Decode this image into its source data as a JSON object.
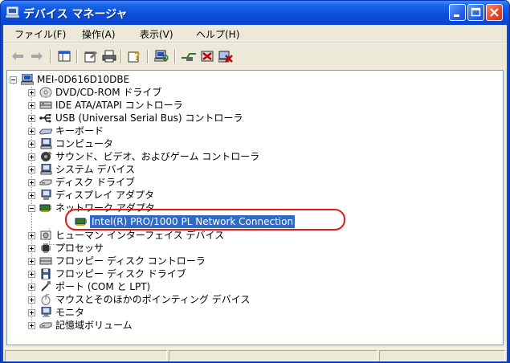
{
  "window": {
    "title": "デバイス マネージャ"
  },
  "menu": [
    {
      "label": "ファイル(F)"
    },
    {
      "label": "操作(A)"
    },
    {
      "label": "表示(V)"
    },
    {
      "label": "ヘルプ(H)"
    }
  ],
  "toolbar": {
    "buttons": [
      {
        "icon": "back-arrow-icon"
      },
      {
        "icon": "forward-arrow-icon"
      },
      {
        "icon": "show-hide-tree-icon"
      },
      {
        "icon": "properties-icon"
      },
      {
        "icon": "print-icon"
      },
      {
        "icon": "help-icon"
      },
      {
        "icon": "scan-hardware-changes-icon"
      },
      {
        "icon": "update-driver-icon"
      },
      {
        "icon": "disable-device-icon"
      },
      {
        "icon": "uninstall-device-icon"
      }
    ]
  },
  "tree": {
    "root": {
      "label": "MEI-0D616D10DBE",
      "expanded": true
    },
    "categories": [
      {
        "label": "DVD/CD-ROM ドライブ",
        "icon": "dvd-drive-icon",
        "expanded": false
      },
      {
        "label": "IDE ATA/ATAPI コントローラ",
        "icon": "ide-controller-icon",
        "expanded": false
      },
      {
        "label": "USB (Universal Serial Bus) コントローラ",
        "icon": "usb-icon",
        "expanded": false
      },
      {
        "label": "キーボード",
        "icon": "keyboard-icon",
        "expanded": false
      },
      {
        "label": "コンピュータ",
        "icon": "computer-icon",
        "expanded": false
      },
      {
        "label": "サウンド、ビデオ、およびゲーム コントローラ",
        "icon": "sound-icon",
        "expanded": false
      },
      {
        "label": "システム デバイス",
        "icon": "system-devices-icon",
        "expanded": false
      },
      {
        "label": "ディスク ドライブ",
        "icon": "disk-drive-icon",
        "expanded": false
      },
      {
        "label": "ディスプレイ アダプタ",
        "icon": "display-adapter-icon",
        "expanded": false
      },
      {
        "label": "ネットワーク アダプタ",
        "icon": "network-adapter-icon",
        "expanded": true,
        "children": [
          {
            "label": "Intel(R) PRO/1000 PL Network Connection",
            "icon": "network-card-icon",
            "selected": true
          }
        ]
      },
      {
        "label": "ヒューマン インターフェイス デバイス",
        "icon": "hid-icon",
        "expanded": false
      },
      {
        "label": "プロセッサ",
        "icon": "processor-icon",
        "expanded": false
      },
      {
        "label": "フロッピー ディスク コントローラ",
        "icon": "floppy-controller-icon",
        "expanded": false
      },
      {
        "label": "フロッピー ディスク ドライブ",
        "icon": "floppy-drive-icon",
        "expanded": false
      },
      {
        "label": "ポート (COM と LPT)",
        "icon": "port-icon",
        "expanded": false
      },
      {
        "label": "マウスとそのほかのポインティング デバイス",
        "icon": "mouse-icon",
        "expanded": false
      },
      {
        "label": "モニタ",
        "icon": "monitor-icon",
        "expanded": false
      },
      {
        "label": "記憶域ボリューム",
        "icon": "storage-volume-icon",
        "expanded": false
      }
    ]
  },
  "colors": {
    "titlebar": "#0a49d6",
    "selection": "#316ac5",
    "highlight_ring": "#e01a1a",
    "chrome": "#ece9d8"
  }
}
